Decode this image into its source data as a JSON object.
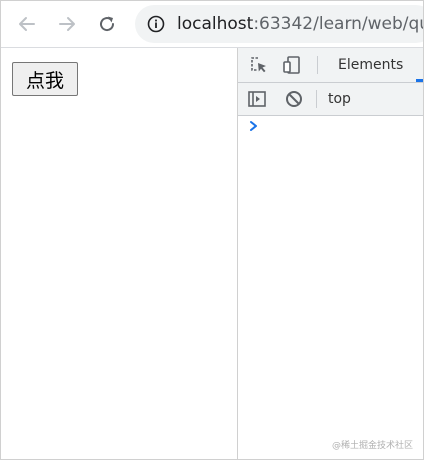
{
  "browser": {
    "url_host": "localhost",
    "url_path": ":63342/learn/web/qu",
    "icons": {
      "back": "arrow-left-icon",
      "forward": "arrow-right-icon",
      "reload": "reload-icon",
      "site_info": "info-circle-icon"
    }
  },
  "page": {
    "button_label": "点我"
  },
  "devtools": {
    "tabs": [
      {
        "label": "Elements",
        "active": true
      }
    ],
    "context_label": "top",
    "icons": {
      "inspect": "inspect-element-icon",
      "device": "device-toolbar-icon",
      "sidebar": "console-sidebar-icon",
      "clear": "clear-console-icon",
      "prompt": "console-prompt-icon"
    },
    "accent_color": "#1a73e8"
  },
  "watermark": "@稀土掘金技术社区"
}
